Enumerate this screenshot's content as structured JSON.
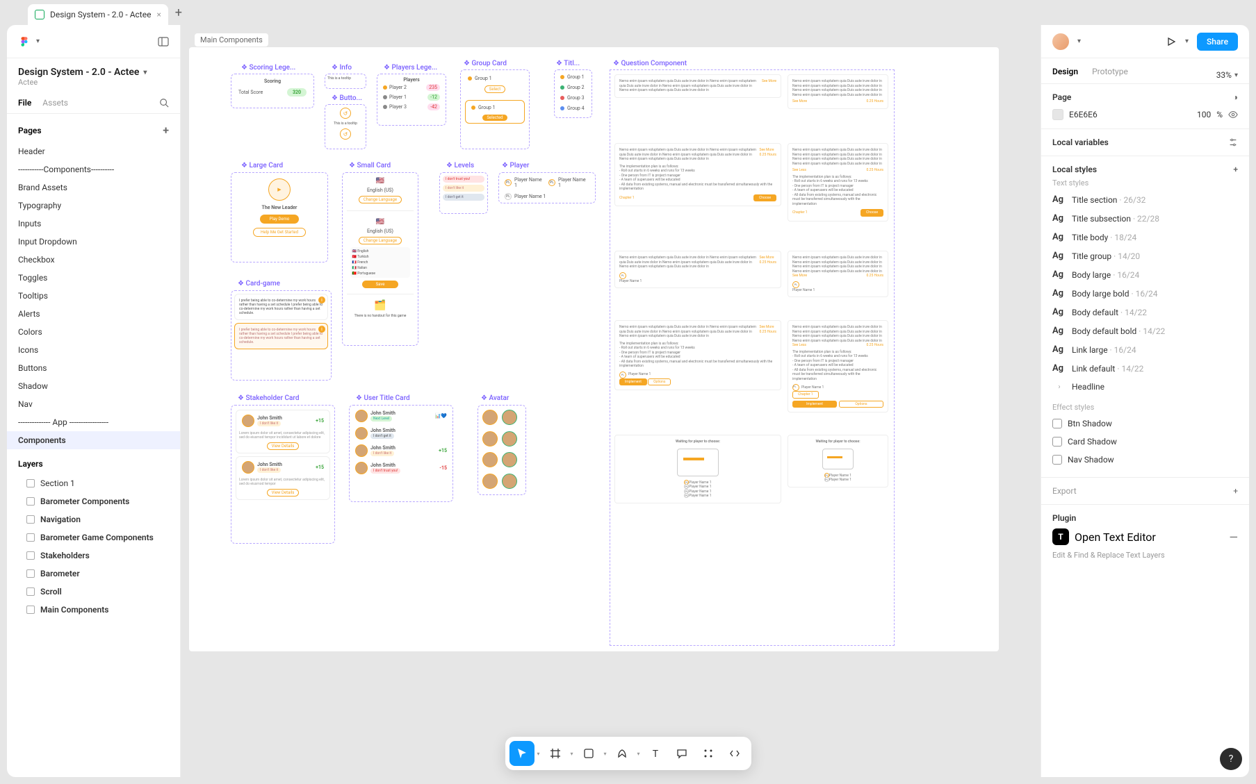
{
  "tab": {
    "title": "Design System - 2.0 - Actee"
  },
  "file": {
    "title": "Design System - 2.0 - Actee",
    "team": "Actee"
  },
  "file_tabs": {
    "file": "File",
    "assets": "Assets"
  },
  "pages": {
    "header": "Pages",
    "items": [
      "Header",
      "-----------Components----------",
      "Brand Assets",
      "Typography",
      "Inputs",
      "Input Dropdown",
      "Checkbox",
      "Toggles",
      "Tooltips",
      "Alerts",
      "Colors",
      "Icons",
      "Buttons",
      "Shadow",
      "Nav",
      "-------------- App -----------------",
      "Components"
    ],
    "selected": 16
  },
  "layers": {
    "header": "Layers",
    "items": [
      "Section 1",
      "Barometer Components",
      "Navigation",
      "Barometer Game Components",
      "Stakeholders",
      "Barometer",
      "Scroll",
      "Main Components"
    ]
  },
  "canvas": {
    "frame_label": "Main Components",
    "components": {
      "scoring_legend": "Scoring Lege...",
      "info": "Info",
      "players_legend": "Players Lege...",
      "group_card": "Group Card",
      "title": "Titl...",
      "question": "Question Component",
      "button": "Butto...",
      "large_card": "Large Card",
      "small_card": "Small Card",
      "levels": "Levels",
      "player": "Player",
      "card_game": "Card-game",
      "stakeholder": "Stakeholder Card",
      "user_title": "User Title Card",
      "avatar": "Avatar"
    },
    "scoring": {
      "title": "Scoring",
      "label": "Total Score",
      "value": "320"
    },
    "info_text": "This is a tooltip",
    "players": {
      "title": "Players",
      "p1": "Player 1",
      "p2": "Player 2",
      "p3": "Player 3",
      "s1": "235",
      "s2": "-12",
      "s3": "-42"
    },
    "groups": {
      "g1": "Group 1",
      "g2": "Group 2",
      "g3": "Group 3",
      "g4": "Group 4",
      "select": "Select",
      "selected": "Selected"
    },
    "large": {
      "title": "The New Leader",
      "play": "Play Demo",
      "help": "Help Me Get Started"
    },
    "small": {
      "lang": "English (US)",
      "change": "Change Language",
      "save": "Save",
      "nohandout": "There is no handout for this game"
    },
    "levels": {
      "l1": "I don't trust you!",
      "l2": "I don't like it",
      "l3": "I don't get it"
    },
    "player_name": "Player Name 1",
    "cardgame": {
      "text": "I prefer being able to co-determine my work hours rather than having a set schedule I prefer being able to co-determine my work hours rather than having a set schedule."
    },
    "stakeholder": {
      "name": "John Smith",
      "score": "+15",
      "neg": "-15",
      "view": "View Details",
      "next": "Next Level",
      "dontlike": "I don't like it",
      "dontget": "I don't get it",
      "donttrust": "I don't trust you!"
    },
    "question": {
      "lorem": "Nemo enim ipsam voluptatem quia Duis aute irure dolor in Nemo enim ipsam voluptatem quia Duis aute irure dolor in Nemo enim ipsam voluptatem quia Duis aute irure dolor in Nemo enim ipsam voluptatem quia Duis aute irure dolor in",
      "see_more": "See More",
      "see_less": "See Less",
      "time": "0.25 Hours",
      "plan": "The implementation plan is as follows:",
      "b1": "- Roll out starts in 6 weeks and runs for 13 weeks",
      "b2": "- One person from IT is project manager",
      "b3": "- A team of superusers will be educated",
      "b4": "- All data from existing systems, manual and electronic must be transferred simultaneously with the implementation",
      "chapter": "Chapter 1",
      "choose": "Choose",
      "implement": "Implement",
      "options": "Options",
      "waiting": "Waiting for player to choose:"
    }
  },
  "rpanel": {
    "tabs": {
      "design": "Design",
      "prototype": "Prototype"
    },
    "zoom": "33%",
    "page": "Page",
    "bg": {
      "hex": "E6E6E6",
      "pct": "100",
      "unit": "%"
    },
    "local_vars": "Local variables",
    "local_styles": "Local styles",
    "text_styles": "Text styles",
    "styles": [
      {
        "name": "Title section",
        "dim": "26/32"
      },
      {
        "name": "Title subsection",
        "dim": "22/28"
      },
      {
        "name": "Title body",
        "dim": "18/24"
      },
      {
        "name": "Title group",
        "dim": "14/20"
      },
      {
        "name": "Body large",
        "dim": "16/24"
      },
      {
        "name": "Body large bold",
        "dim": "16/24"
      },
      {
        "name": "Body default",
        "dim": "14/22"
      },
      {
        "name": "Body default bold",
        "dim": "14/22"
      },
      {
        "name": "Link large",
        "dim": "16/24"
      },
      {
        "name": "Link default",
        "dim": "14/22"
      }
    ],
    "headline": "Headline",
    "effect_styles": "Effect styles",
    "effects": [
      "Btn Shadow",
      "Card Shadow",
      "Nav Shadow"
    ],
    "export": "Export",
    "plugin": "Plugin",
    "plugin_name": "Open Text Editor",
    "plugin_desc": "Edit & Find & Replace Text Layers",
    "share": "Share"
  }
}
